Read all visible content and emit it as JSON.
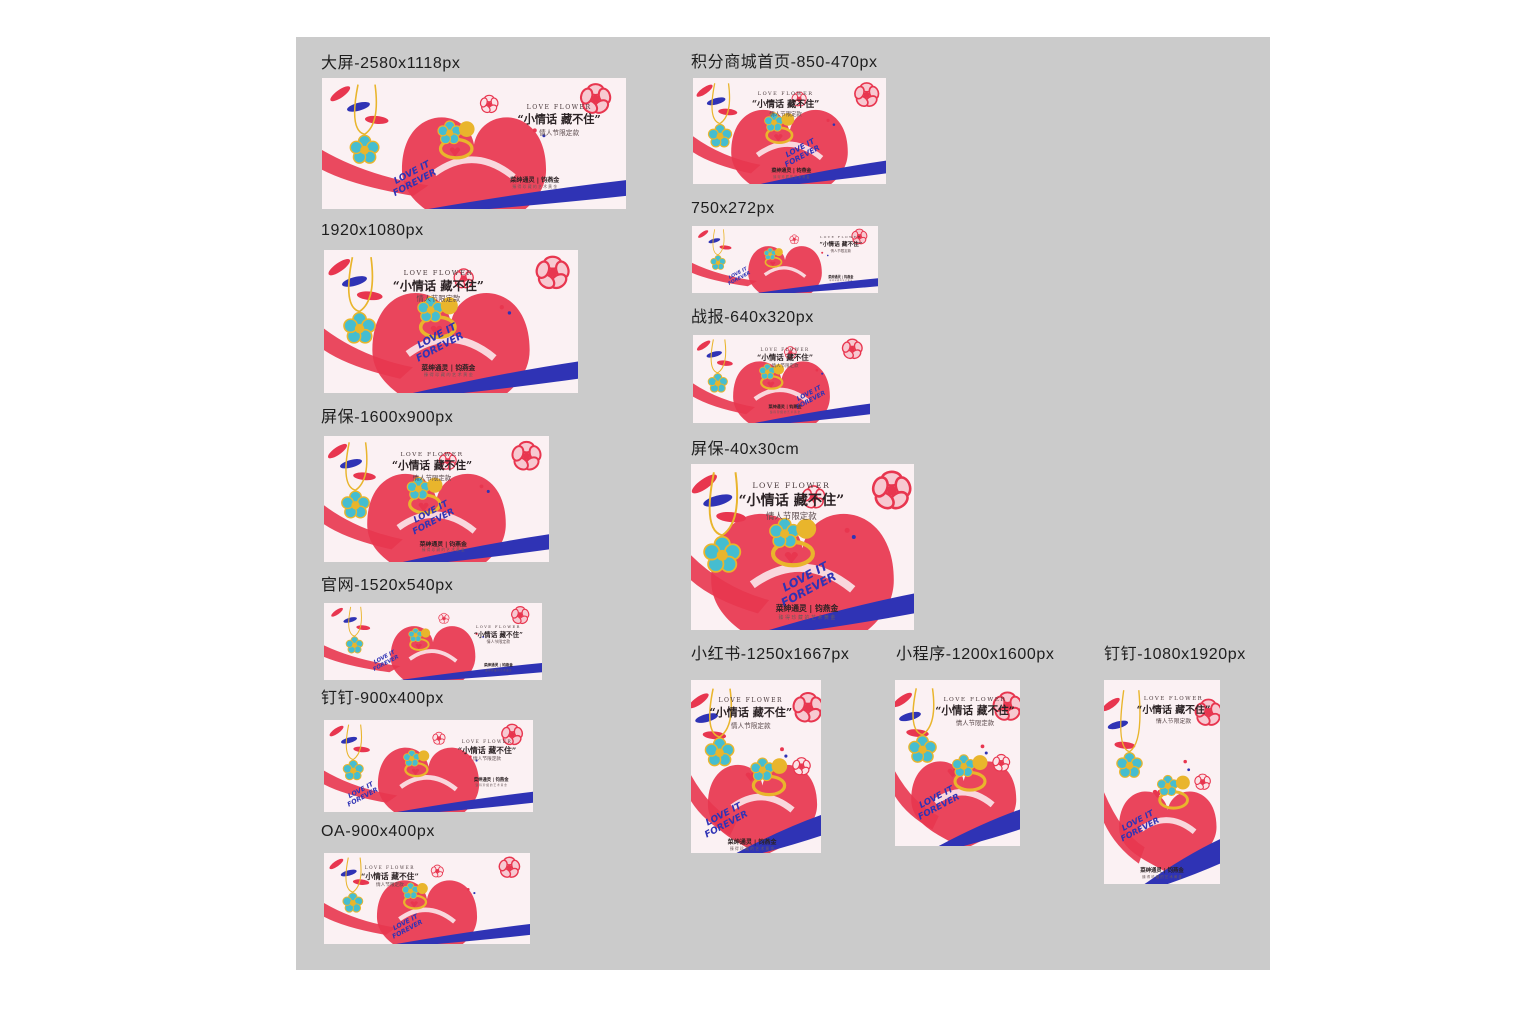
{
  "campaign": {
    "en_title": "LOVE FLOWER",
    "headline": "“小情话  藏不住”",
    "subheadline": "情人节限定款",
    "brand": "菜绅通灵 | 钧燕金",
    "brand_tagline": "臻 得 珍 藏 的 艺 术 黄 金",
    "slogan_top": "LOVE IT",
    "slogan_bottom": "FOREVER"
  },
  "colors": {
    "board": "#cbcbcb",
    "banner_bg": "#fbf1f3",
    "red": "#e8364f",
    "blue": "#2f33b5",
    "gold": "#e9b52c",
    "turquoise": "#45bdd0"
  },
  "variants": [
    {
      "label": "大屏-2580x1118px",
      "layout": "wide"
    },
    {
      "label": "1920x1080px",
      "layout": "wide"
    },
    {
      "label": "屏保-1600x900px",
      "layout": "wide"
    },
    {
      "label": "官网-1520x540px",
      "layout": "wide"
    },
    {
      "label": "钉钉-900x400px",
      "layout": "wide"
    },
    {
      "label": "OA-900x400px",
      "layout": "wide"
    },
    {
      "label": "积分商城首页-850-470px",
      "layout": "wide"
    },
    {
      "label": "750x272px",
      "layout": "wide"
    },
    {
      "label": "战报-640x320px",
      "layout": "wide"
    },
    {
      "label": "屏保-40x30cm",
      "layout": "wide"
    },
    {
      "label": "小红书-1250x1667px",
      "layout": "tall"
    },
    {
      "label": "小程序-1200x1600px",
      "layout": "tall"
    },
    {
      "label": "钉钉-1080x1920px",
      "layout": "tall"
    }
  ]
}
